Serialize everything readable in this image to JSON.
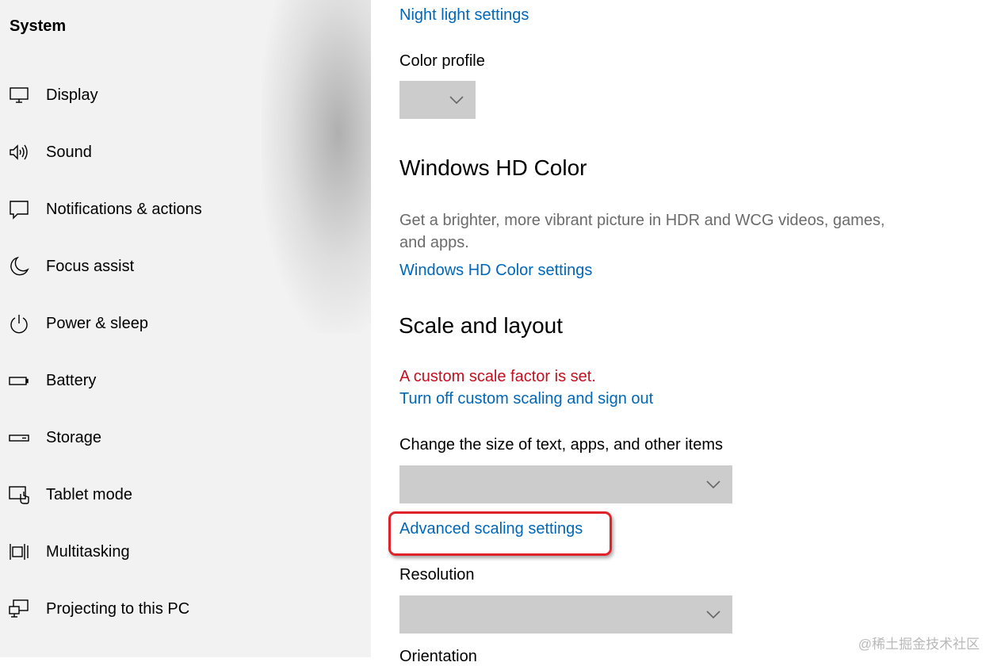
{
  "sidebar": {
    "title": "System",
    "items": [
      {
        "label": "Display",
        "icon": "monitor-icon"
      },
      {
        "label": "Sound",
        "icon": "speaker-icon"
      },
      {
        "label": "Notifications & actions",
        "icon": "notification-icon"
      },
      {
        "label": "Focus assist",
        "icon": "moon-icon"
      },
      {
        "label": "Power & sleep",
        "icon": "power-icon"
      },
      {
        "label": "Battery",
        "icon": "battery-icon"
      },
      {
        "label": "Storage",
        "icon": "storage-icon"
      },
      {
        "label": "Tablet mode",
        "icon": "tablet-icon"
      },
      {
        "label": "Multitasking",
        "icon": "multitasking-icon"
      },
      {
        "label": "Projecting to this PC",
        "icon": "projecting-icon"
      }
    ]
  },
  "main": {
    "night_light_link": "Night light settings",
    "color_profile_label": "Color profile",
    "hd_color": {
      "heading": "Windows HD Color",
      "description": "Get a brighter, more vibrant picture in HDR and WCG videos, games, and apps.",
      "link": "Windows HD Color settings"
    },
    "scale_layout": {
      "heading": "Scale and layout",
      "warning": "A custom scale factor is set.",
      "turn_off_link": "Turn off custom scaling and sign out",
      "size_label": "Change the size of text, apps, and other items",
      "advanced_link": "Advanced scaling settings",
      "resolution_label": "Resolution",
      "orientation_label": "Orientation"
    }
  },
  "watermark": "@稀土掘金技术社区",
  "colors": {
    "link": "#0067b8",
    "warning": "#c50f1f",
    "highlight": "#e0232b",
    "dropdown": "#cccccc"
  }
}
